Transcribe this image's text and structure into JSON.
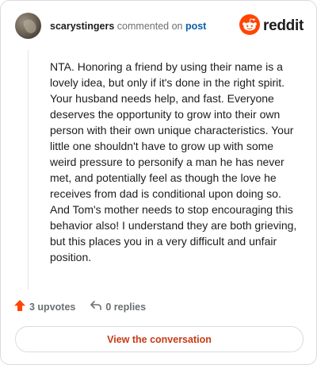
{
  "header": {
    "username": "scarystingers",
    "action_text": " commented on ",
    "link_text": "post",
    "brand": "reddit",
    "logo_icon": "reddit-snoo-icon"
  },
  "comment": {
    "body": "NTA. Honoring a friend by using their name is a lovely idea, but only if it's done in the right spirit. Your husband needs help, and fast. Everyone deserves the opportunity to grow into their own person with their own unique characteristics. Your little one shouldn't have to grow up with some weird pressure to personify a man he has never met, and potentially feel as though the love he receives from dad is conditional upon doing so. And Tom's mother needs to stop encouraging this behavior also! I understand they are both grieving, but this places you in a very difficult and unfair position."
  },
  "actions": {
    "upvotes_label": "3 upvotes",
    "upvote_icon": "upvote-arrow-icon",
    "replies_label": "0 replies",
    "reply_icon": "reply-arrow-icon"
  },
  "cta": {
    "label": "View the conversation"
  },
  "colors": {
    "accent": "#ff4500",
    "link": "#0b5ea8",
    "cta_text": "#c83a14"
  }
}
